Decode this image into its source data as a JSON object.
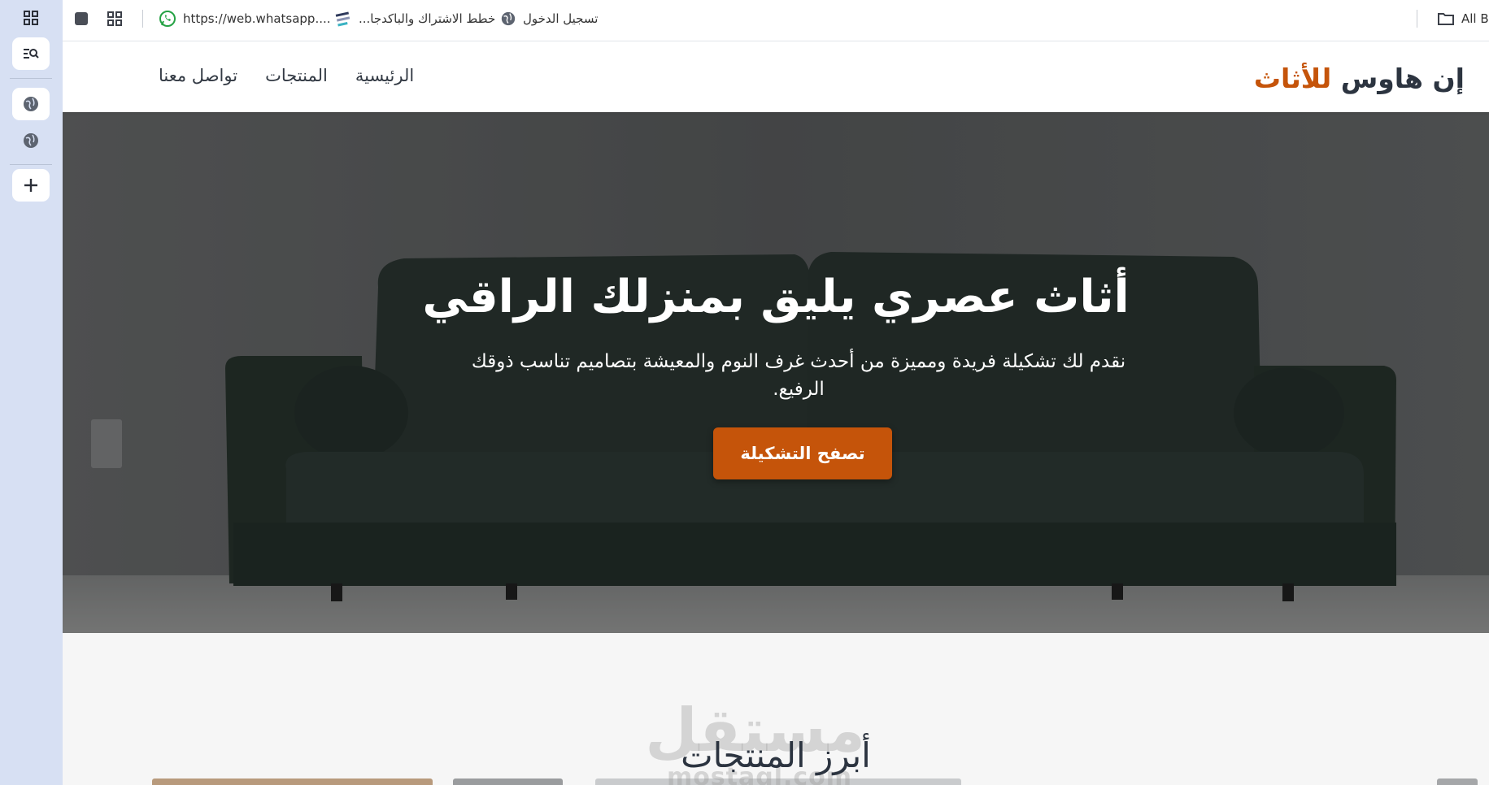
{
  "bookmarks": [
    {
      "label": "https://web.whatsapp....",
      "icon": "whatsapp-icon"
    },
    {
      "label": "خطط الاشتراك والباكدجا...",
      "icon": "stripes-logo-icon"
    },
    {
      "label": "تسجيل الدخول",
      "icon": "globe-icon"
    }
  ],
  "bookmarks_overflow": "All B",
  "site": {
    "logo_main": "إن هاوس ",
    "logo_accent": "للأثاث",
    "nav": [
      "الرئيسية",
      "المنتجات",
      "تواصل معنا"
    ]
  },
  "hero": {
    "title": "أثاث عصري يليق بمنزلك الراقي",
    "subtitle": "نقدم لك تشكيلة فريدة ومميزة من أحدث غرف النوم والمعيشة بتصاميم تناسب ذوقك الرفيع.",
    "cta": "تصفح التشكيلة"
  },
  "products": {
    "title": "أبرز المنتجات"
  },
  "watermark": {
    "arabic": "مستقل",
    "latin": "mostaql.com"
  },
  "colors": {
    "accent": "#c5540a",
    "text_dark": "#2c3440",
    "sofa": "#243430"
  }
}
